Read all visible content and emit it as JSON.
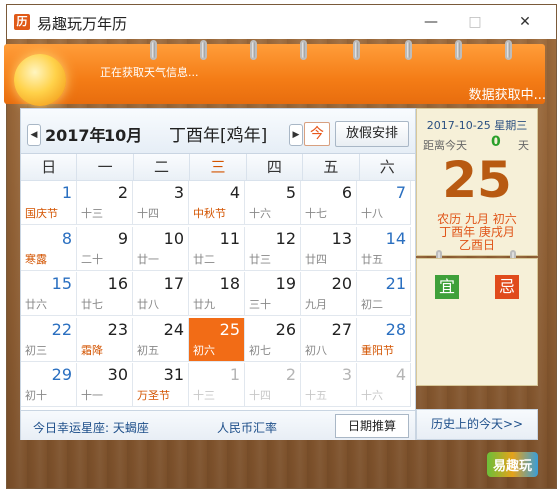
{
  "window": {
    "title": "易趣玩万年历",
    "logo": "历"
  },
  "controls": {
    "min": "—",
    "max": "□",
    "close": "✕"
  },
  "header": {
    "weather_status": "正在获取天气信息...",
    "data_status": "数据获取中..."
  },
  "nav": {
    "prev": "◀",
    "next": "▶",
    "year": "2017年",
    "month": "10月",
    "ganzhi": "丁酉年[鸡年]",
    "today": "今",
    "holiday": "放假安排"
  },
  "weekdays": [
    "日",
    "一",
    "二",
    "三",
    "四",
    "五",
    "六"
  ],
  "days": [
    {
      "d": "1",
      "l": "国庆节",
      "t": "blue",
      "lt": "red"
    },
    {
      "d": "2",
      "l": "十三"
    },
    {
      "d": "3",
      "l": "十四"
    },
    {
      "d": "4",
      "l": "中秋节",
      "lt": "red"
    },
    {
      "d": "5",
      "l": "十六"
    },
    {
      "d": "6",
      "l": "十七"
    },
    {
      "d": "7",
      "l": "十八",
      "t": "blue"
    },
    {
      "d": "8",
      "l": "寒露",
      "t": "blue",
      "lt": "red"
    },
    {
      "d": "9",
      "l": "二十"
    },
    {
      "d": "10",
      "l": "廿一"
    },
    {
      "d": "11",
      "l": "廿二"
    },
    {
      "d": "12",
      "l": "廿三"
    },
    {
      "d": "13",
      "l": "廿四"
    },
    {
      "d": "14",
      "l": "廿五",
      "t": "blue"
    },
    {
      "d": "15",
      "l": "廿六",
      "t": "blue"
    },
    {
      "d": "16",
      "l": "廿七"
    },
    {
      "d": "17",
      "l": "廿八"
    },
    {
      "d": "18",
      "l": "廿九"
    },
    {
      "d": "19",
      "l": "三十"
    },
    {
      "d": "20",
      "l": "九月"
    },
    {
      "d": "21",
      "l": "初二",
      "t": "blue"
    },
    {
      "d": "22",
      "l": "初三",
      "t": "blue"
    },
    {
      "d": "23",
      "l": "霜降",
      "lt": "red"
    },
    {
      "d": "24",
      "l": "初五"
    },
    {
      "d": "25",
      "l": "初六",
      "sel": true
    },
    {
      "d": "26",
      "l": "初七"
    },
    {
      "d": "27",
      "l": "初八"
    },
    {
      "d": "28",
      "l": "重阳节",
      "t": "blue",
      "lt": "red"
    },
    {
      "d": "29",
      "l": "初十",
      "t": "blue"
    },
    {
      "d": "30",
      "l": "十一"
    },
    {
      "d": "31",
      "l": "万圣节",
      "lt": "red"
    },
    {
      "d": "1",
      "l": "十三",
      "t": "grey",
      "lt": "grey"
    },
    {
      "d": "2",
      "l": "十四",
      "t": "grey",
      "lt": "grey"
    },
    {
      "d": "3",
      "l": "十五",
      "t": "grey",
      "lt": "grey"
    },
    {
      "d": "4",
      "l": "十六",
      "t": "grey",
      "lt": "grey"
    }
  ],
  "footer": {
    "lucky": "今日幸运星座: 天蝎座",
    "rate": "人民币汇率",
    "calc": "日期推算"
  },
  "detail": {
    "date": "2017-10-25 星期三",
    "away_label": "距离今天",
    "away_num": "0",
    "away_unit": "天",
    "big_day": "25",
    "lunar_line1": "农历 九月 初六",
    "lunar_line2": "丁酉年 庚戌月",
    "lunar_line3": "乙酉日",
    "yi": "宜",
    "ji": "忌"
  },
  "history": "历史上的今天>>",
  "brand": "易趣玩",
  "colors": {
    "accent": "#f26c16",
    "blue": "#2a6fc0",
    "red": "#d35400"
  }
}
